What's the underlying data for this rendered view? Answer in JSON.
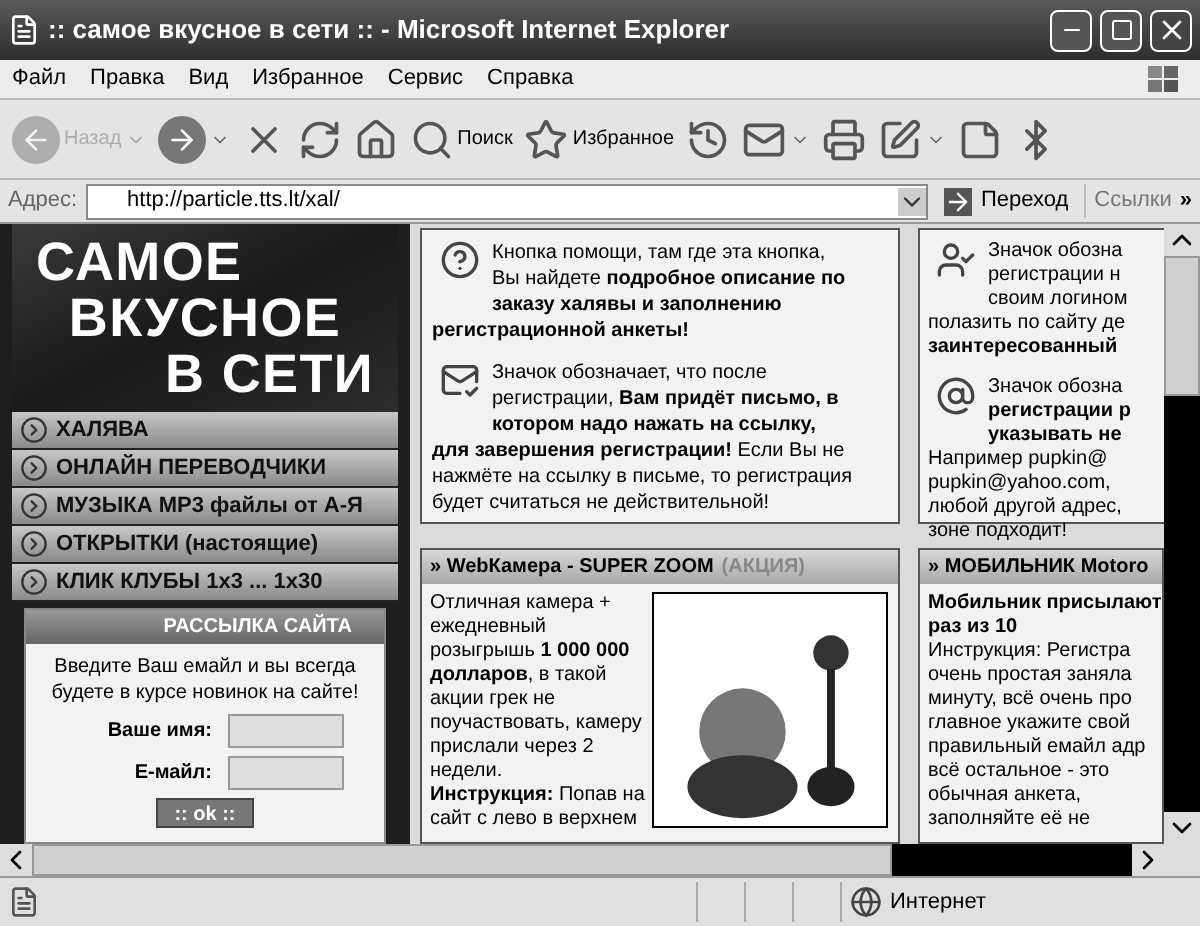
{
  "window": {
    "title": ":: самое вкусное в сети :: - Microsoft Internet Explorer"
  },
  "menu": [
    "Файл",
    "Правка",
    "Вид",
    "Избранное",
    "Сервис",
    "Справка"
  ],
  "toolbar": [
    {
      "kind": "back",
      "label": "Назад",
      "disabled": true
    },
    {
      "kind": "forward",
      "disabled": false
    },
    {
      "kind": "stop",
      "disabled": false
    },
    {
      "kind": "refresh",
      "disabled": false
    },
    {
      "kind": "home",
      "disabled": false
    },
    {
      "kind": "search",
      "label": "Поиск",
      "disabled": false
    },
    {
      "kind": "favorites",
      "label": "Избранное",
      "disabled": false
    },
    {
      "kind": "history",
      "disabled": false
    },
    {
      "kind": "mail",
      "disabled": false
    },
    {
      "kind": "print",
      "disabled": false
    },
    {
      "kind": "edit",
      "disabled": false
    },
    {
      "kind": "note",
      "disabled": false
    },
    {
      "kind": "bluetooth",
      "disabled": false
    }
  ],
  "address": {
    "label": "Адрес:",
    "url": "http://particle.tts.lt/xal/",
    "go": "Переход",
    "links": "Ссылки",
    "more": "»"
  },
  "sidebar": {
    "logo": [
      "САМОЕ",
      "ВКУСНОЕ",
      "В СЕТИ"
    ],
    "items": [
      "ХАЛЯВА",
      "ОНЛАЙН ПЕРЕВОДЧИКИ",
      "МУЗЫКА MP3 файлы от А-Я",
      "ОТКРЫТКИ (настоящие)",
      "КЛИК КЛУБЫ 1x3 ... 1x30"
    ],
    "newsletter": {
      "title": "РАССЫЛКА САЙТА",
      "text": "Введите Ваш емайл и вы всегда будете в курсе новинок на сайте!",
      "fields": [
        {
          "label": "Ваше имя:"
        },
        {
          "label": "Е-майл:"
        }
      ],
      "button": ":: ok ::"
    }
  },
  "info_box": {
    "items": [
      {
        "kind": "help",
        "beside": [
          "Кнопка помощи, там где эта кнопка,",
          "Вы найдете **подробное описание по**",
          "**заказу халявы и заполнению**"
        ],
        "below": [
          "**регистрационной анкеты!**"
        ]
      },
      {
        "kind": "mail",
        "beside": [
          "Значок обозначает, что после",
          "регистрации, **Вам придёт письмо, в**",
          "**котором надо нажать на ссылку,**"
        ],
        "below": [
          "**для завершения регистрации!** Если Вы не",
          "нажмёте на ссылку в письме, то регистрация",
          "будет считаться не действительной!"
        ]
      }
    ]
  },
  "right_info": {
    "items": [
      {
        "kind": "login",
        "beside": [
          "Значок обозна",
          "регистрации н",
          "своим логином"
        ],
        "below": [
          "полазить по сайту де",
          "**заинтересованный**"
        ]
      },
      {
        "kind": "email",
        "beside": [
          "Значок обозна",
          "**регистрации р**",
          "**указывать не**"
        ],
        "below": [
          "Например pupkin@",
          "pupkin@yahoo.com,",
          "любой другой адрес,",
          "зоне подходит!"
        ]
      }
    ]
  },
  "offers": [
    {
      "title": "» WebКамера - SUPER ZOOM",
      "tag": "(АКЦИЯ)",
      "photo": true,
      "lines": [
        "Отличная камера +",
        "ежедневный",
        "розыгрышь **1 000 000**",
        "**долларов**, в такой",
        "акции грек не",
        "поучаствовать, камеру",
        "прислали через 2",
        "недели.",
        "**Инструкция:** Попав на",
        "сайт с лево в верхнем"
      ]
    },
    {
      "title": "» МОБИЛЬНИК Motoro",
      "photo": false,
      "lines": [
        "**Мобильник присылают**",
        "**раз из 10**",
        "Инструкция: Регистра",
        "очень простая заняла",
        "минуту, всё очень про",
        "главное укажите свой",
        "правильный емайл адр",
        "всё остальное - это",
        "обычная анкета,",
        "заполняйте её не"
      ]
    }
  ],
  "status_bar": {
    "zone": "Интернет"
  }
}
